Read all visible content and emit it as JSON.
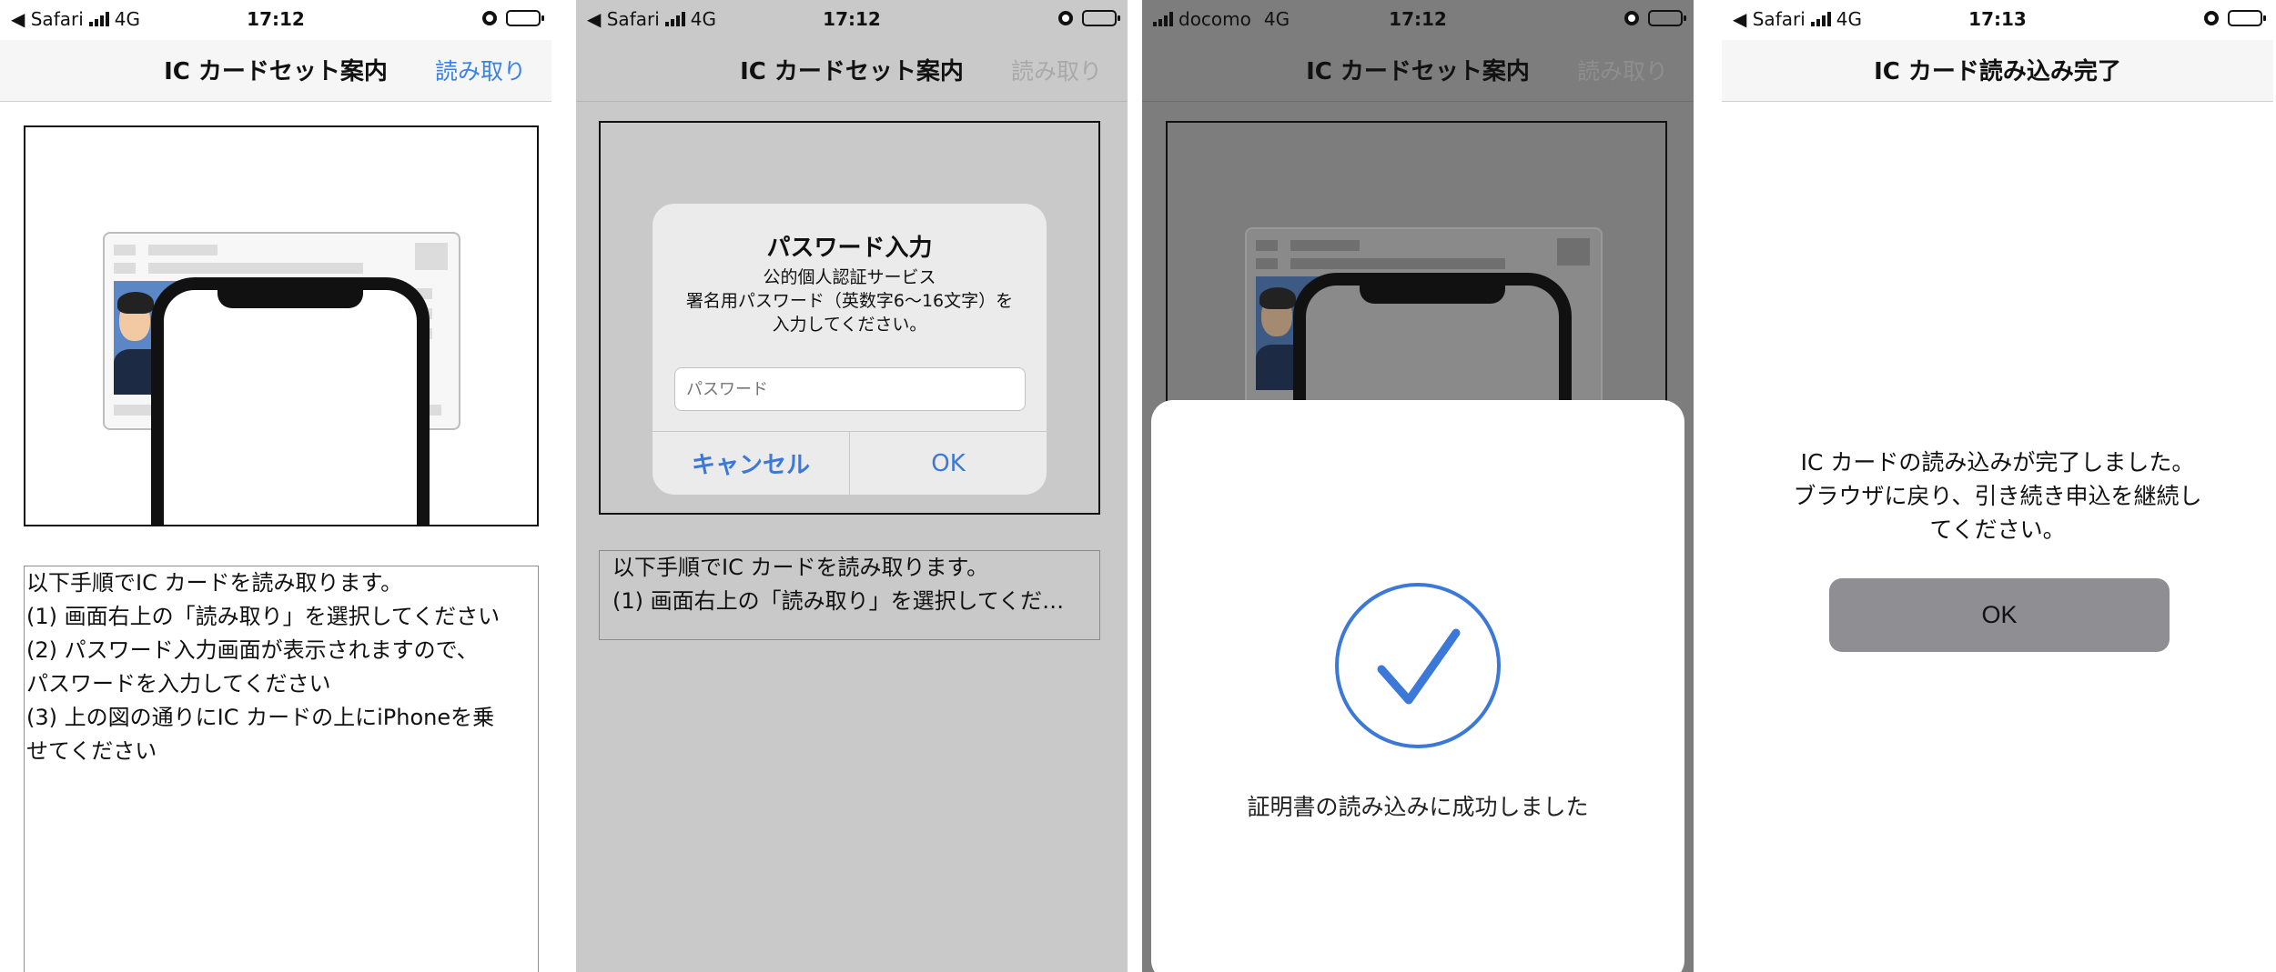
{
  "screens": [
    {
      "status": {
        "left": "◀ Safari",
        "network": "4G",
        "time": "17:12"
      },
      "nav": {
        "title": "IC カードセット案内",
        "action": "読み取り"
      },
      "instructions": [
        "以下手順でIC カードを読み取ります。",
        "(1) 画面右上の「読み取り」を選択してください",
        "(2) パスワード入力画面が表示されますので、",
        "パスワードを入力してください",
        "(3) 上の図の通りにIC カードの上にiPhoneを乗",
        "せてください"
      ]
    },
    {
      "status": {
        "left": "◀ Safari",
        "network": "4G",
        "time": "17:12"
      },
      "nav": {
        "title": "IC カードセット案内",
        "action": "読み取り"
      },
      "dialog": {
        "title": "パスワード入力",
        "subtitle_lines": [
          "公的個人認証サービス",
          "署名用パスワード（英数字6〜16文字）を",
          "入力してください。"
        ],
        "placeholder": "パスワード",
        "cancel": "キャンセル",
        "ok": "OK"
      },
      "instructions": [
        "以下手順でIC カードを読み取ります。",
        "(1) 画面右上の「読み取り」を選択してくだ…"
      ]
    },
    {
      "status": {
        "left": "docomo",
        "network": "4G",
        "time": "17:12"
      },
      "nav": {
        "title": "IC カードセット案内",
        "action": "読み取り"
      },
      "success_message": "証明書の読み込みに成功しました",
      "check_color": "#3b78d8"
    },
    {
      "status": {
        "left": "◀ Safari",
        "network": "4G",
        "time": "17:13"
      },
      "nav": {
        "title": "IC カード読み込み完了"
      },
      "message_lines": [
        "IC カードの読み込みが完了しました。",
        "ブラウザに戻り、引き続き申込を継続し",
        "てください。"
      ],
      "ok": "OK"
    }
  ],
  "colors": {
    "accent": "#3b82e6",
    "disabled_action": "#a9a9a9",
    "button_gray": "#8e8e93"
  }
}
